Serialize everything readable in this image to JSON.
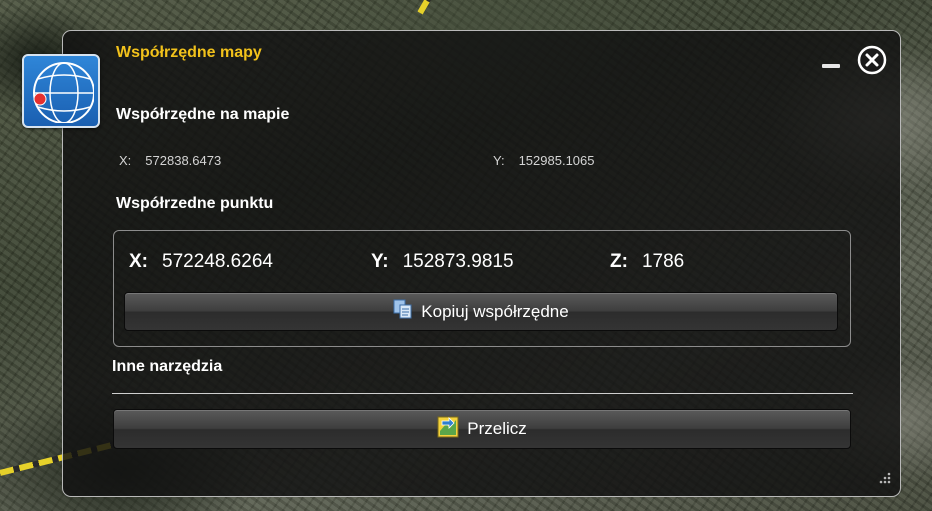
{
  "dialog": {
    "title": "Współrzędne mapy",
    "map_coords": {
      "heading": "Współrzędne na mapie",
      "x_label": "X:",
      "x_value": "572838.6473",
      "y_label": "Y:",
      "y_value": "152985.1065"
    },
    "point_coords": {
      "heading": "Współrzedne punktu",
      "x_label": "X:",
      "x_value": "572248.6264",
      "y_label": "Y:",
      "y_value": "152873.9815",
      "z_label": "Z:",
      "z_value": "1786",
      "copy_button": "Kopiuj współrzędne"
    },
    "other_tools": {
      "heading": "Inne narzędzia",
      "convert_button": "Przelicz"
    }
  },
  "icons": {
    "app": "globe-icon",
    "minimize": "minimize-icon",
    "close": "close-icon",
    "copy": "copy-icon",
    "convert": "convert-icon",
    "resize": "resize-grip-icon"
  },
  "colors": {
    "title": "#f2c21b",
    "panel_bg": "#121212",
    "text": "#ffffff",
    "muted_text": "#d4d4d4"
  }
}
